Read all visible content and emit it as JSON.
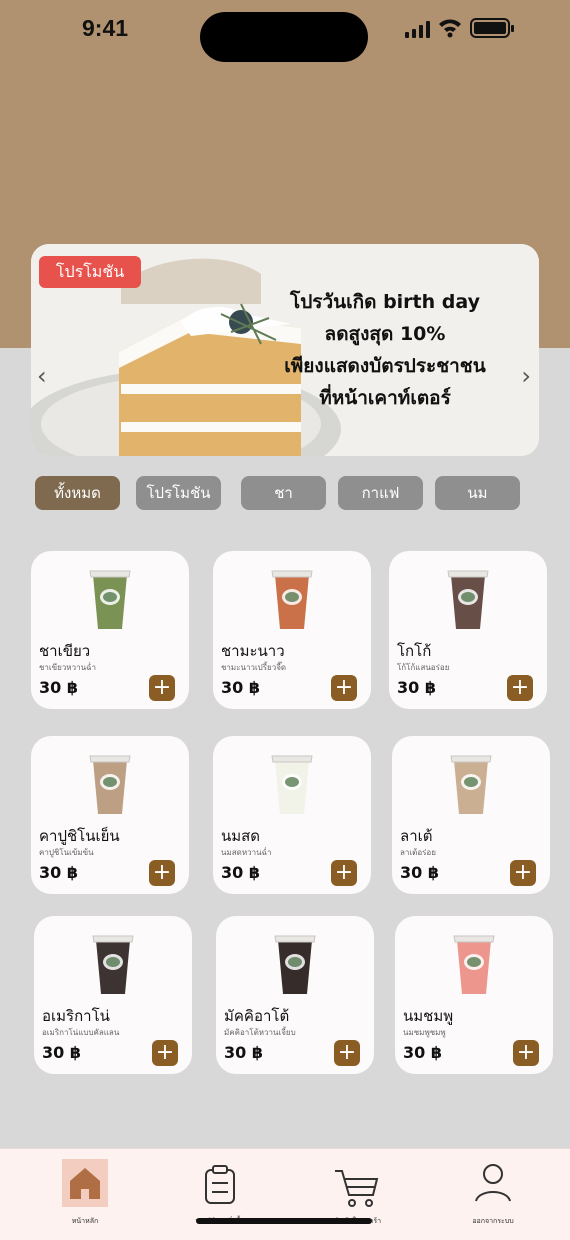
{
  "status_bar": {
    "time": "9:41"
  },
  "banner": {
    "tag": "โปรโมชัน",
    "lines": [
      "โปรวันเกิด birth day",
      "ลดสูงสุด 10%",
      "เพียงแสดงบัตรประชาชน",
      "ที่หน้าเคาท์เตอร์"
    ],
    "prev_icon": "chevron-left-icon",
    "next_icon": "chevron-right-icon"
  },
  "filters": [
    {
      "label": "ทั้งหมด",
      "active": true
    },
    {
      "label": "โปรโมชัน",
      "active": false
    },
    {
      "label": "ชา",
      "active": false
    },
    {
      "label": "กาแฟ",
      "active": false
    },
    {
      "label": "นม",
      "active": false
    }
  ],
  "products": [
    {
      "name": "ชาเขียว",
      "desc": "ชาเขียวหวานฉ่ำ",
      "price": "30 ฿",
      "color": "#6f8a45"
    },
    {
      "name": "ชามะนาว",
      "desc": "ชามะนาวเปรี้ยวจี๊ด",
      "price": "30 ฿",
      "color": "#c7653a"
    },
    {
      "name": "โกโก้",
      "desc": "โก้โก้แสนอร่อย",
      "price": "30 ฿",
      "color": "#5a3f36"
    },
    {
      "name": "คาปูชิโนเย็น",
      "desc": "คาปูชิโนเข้มข้น",
      "price": "30 ฿",
      "color": "#b7987a"
    },
    {
      "name": "นมสด",
      "desc": "นมสดหวานฉ่ำ",
      "price": "30 ฿",
      "color": "#f0f1e6"
    },
    {
      "name": "ลาเต้",
      "desc": "ลาเต้อร่อย",
      "price": "30 ฿",
      "color": "#c7a889"
    },
    {
      "name": "อเมริกาโน่",
      "desc": "อเมริกาโน่แบบคัลแลน",
      "price": "30 ฿",
      "color": "#2b2221"
    },
    {
      "name": "มัคคิอาโต้",
      "desc": "มัคคิอาโต้หวานเจี้ยบ",
      "price": "30 ฿",
      "color": "#251b19"
    },
    {
      "name": "นมชมพู",
      "desc": "นมชมพูชมพู",
      "price": "30 ฿",
      "color": "#ea8d84"
    }
  ],
  "add_label": "+",
  "nav": [
    {
      "label": "หน้าหลัก",
      "icon": "home-icon",
      "active": true
    },
    {
      "label": "ประวัติการสั่งซื้อ",
      "icon": "clipboard-icon",
      "active": false
    },
    {
      "label": "สินค้าในตะกร้า",
      "icon": "cart-icon",
      "active": false
    },
    {
      "label": "ออกจากระบบ",
      "icon": "user-icon",
      "active": false
    }
  ],
  "colors": {
    "brand": "#b09170",
    "accent": "#8a5d24",
    "promo": "#e7524d",
    "chip_active": "#7f6a4f",
    "chip": "#8f8f8f"
  }
}
